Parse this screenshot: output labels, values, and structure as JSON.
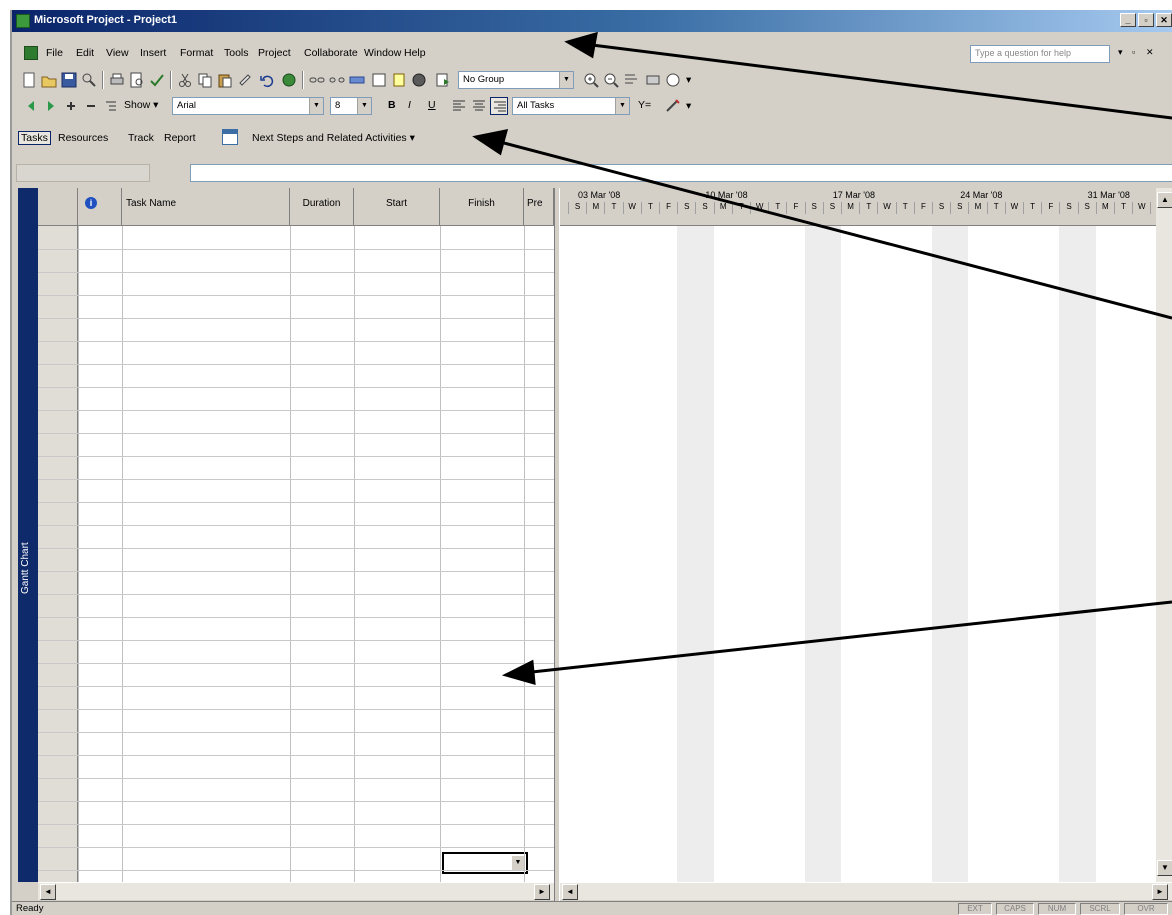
{
  "window": {
    "title": "Microsoft Project - Project1",
    "minimize": "_",
    "restore": "▫",
    "close": "✕"
  },
  "menu": {
    "items": [
      "File",
      "Edit",
      "View",
      "Insert",
      "Format",
      "Tools",
      "Project",
      "Collaborate",
      "Window",
      "Help"
    ],
    "ask_placeholder": "Type a question for help"
  },
  "toolbar1": {
    "group_value": "No Group"
  },
  "toolbar2": {
    "show_label": "Show",
    "font_value": "Arial",
    "size_value": "8",
    "bold": "B",
    "italic": "I",
    "underline": "U",
    "filter_value": "All Tasks",
    "autofilter": "Y="
  },
  "guide": {
    "tasks": "Tasks",
    "resources": "Resources",
    "track": "Track",
    "report": "Report",
    "next_steps": "Next Steps and Related Activities"
  },
  "viewbar": {
    "label": "Gantt Chart"
  },
  "sheet": {
    "columns": [
      "Task Name",
      "Duration",
      "Start",
      "Finish",
      "Pre"
    ]
  },
  "gantt": {
    "weeks": [
      "03 Mar '08",
      "10 Mar '08",
      "17 Mar '08",
      "24 Mar '08",
      "31 Mar '08"
    ],
    "days": [
      "S",
      "M",
      "T",
      "W",
      "T",
      "F",
      "S"
    ]
  },
  "status": {
    "ready": "Ready",
    "panels": [
      "EXT",
      "CAPS",
      "NUM",
      "SCRL",
      "OVR"
    ]
  },
  "colors": {
    "title_start": "#0a246a",
    "title_end": "#a6caf0",
    "viewbar": "#0f2a6b"
  }
}
